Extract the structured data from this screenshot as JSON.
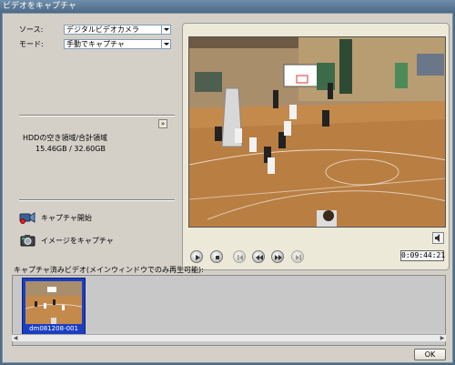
{
  "window": {
    "title": "ビデオをキャプチャ"
  },
  "source": {
    "label": "ソース:",
    "value": "デジタルビデオカメラ"
  },
  "mode": {
    "label": "モード:",
    "value": "手動でキャプチャ"
  },
  "disk": {
    "label": "HDDの空き領域/合計領域",
    "value": "15.46GB / 32.60GB"
  },
  "actions": {
    "start_capture": "キャプチャ開始",
    "capture_image": "イメージをキャプチャ"
  },
  "player": {
    "timecode": "0:09:44:21"
  },
  "captured": {
    "label": "キャプチャ済みビデオ(メインウィンドウでのみ再生可能):",
    "items": [
      {
        "name": "dm081208-001"
      }
    ]
  },
  "buttons": {
    "ok": "OK"
  }
}
